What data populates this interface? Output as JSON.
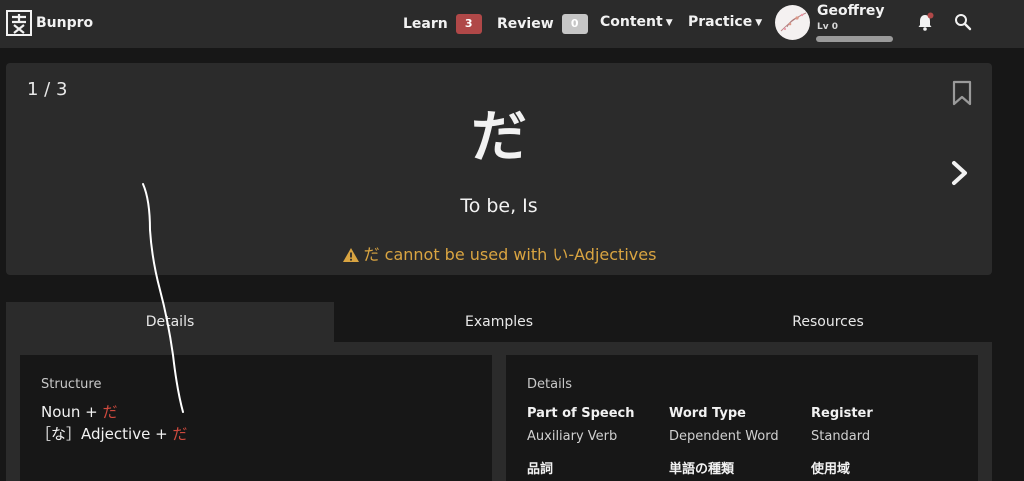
{
  "nav": {
    "brand": "Bunpro",
    "learn_label": "Learn",
    "learn_count": "3",
    "review_label": "Review",
    "review_count": "0",
    "content_label": "Content",
    "practice_label": "Practice",
    "user_name": "Geoffrey",
    "user_level": "Lv 0",
    "icons": [
      "bunpro-logo-icon",
      "bell-icon",
      "search-icon"
    ]
  },
  "hero": {
    "counter": "1 / 3",
    "grammar_point": "だ",
    "meaning": "To be, Is",
    "warning": "だ cannot be used with い-Adjectives",
    "icons": [
      "bookmark-icon",
      "chevron-right-icon",
      "warning-icon"
    ]
  },
  "tabs": [
    "Details",
    "Examples",
    "Resources"
  ],
  "structure": {
    "heading": "Structure",
    "line1_prefix": "Noun + ",
    "line1_highlight": "だ",
    "line2_prefix": "［な］Adjective + ",
    "line2_highlight": "だ"
  },
  "details": {
    "heading": "Details",
    "part_of_speech_label": "Part of Speech",
    "part_of_speech_value": "Auxiliary Verb",
    "word_type_label": "Word Type",
    "word_type_value": "Dependent Word",
    "register_label": "Register",
    "register_value": "Standard",
    "part_of_speech_label_jp": "品詞",
    "word_type_label_jp": "単語の種類",
    "register_label_jp": "使用域"
  },
  "colors": {
    "accent_red": "#d04a3e",
    "warning_yellow": "#d9a441",
    "learn_badge": "#b04848",
    "review_badge": "#c6c6c6"
  }
}
